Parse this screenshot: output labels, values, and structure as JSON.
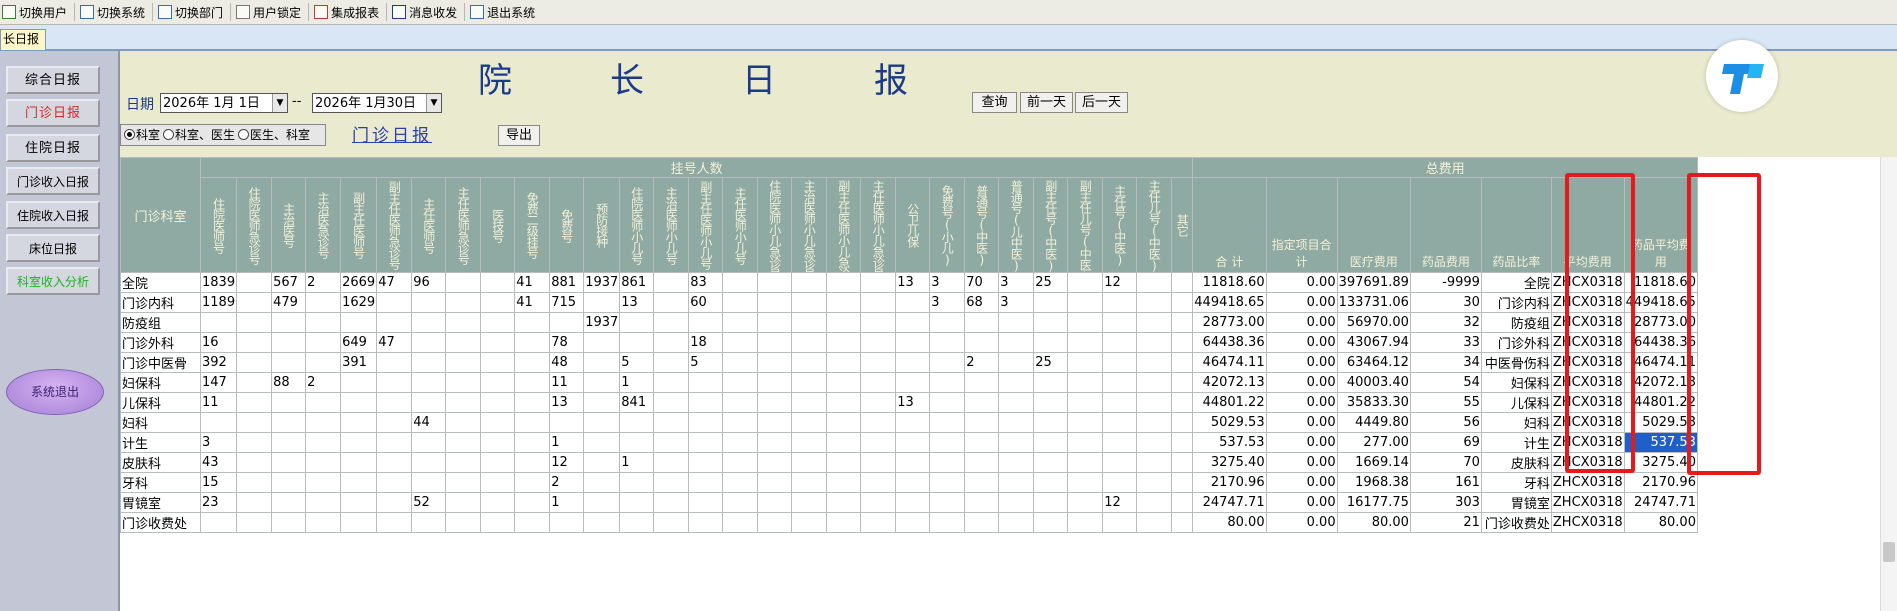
{
  "toolbar": {
    "items": [
      {
        "label": "切换用户",
        "icon": "switch-user-icon"
      },
      {
        "label": "切换系统",
        "icon": "switch-system-icon"
      },
      {
        "label": "切换部门",
        "icon": "switch-department-icon"
      },
      {
        "label": "用户锁定",
        "icon": "user-lock-icon"
      },
      {
        "label": "集成报表",
        "icon": "report-icon"
      },
      {
        "label": "消息收发",
        "icon": "info-icon"
      },
      {
        "label": "退出系统",
        "icon": "exit-icon"
      }
    ]
  },
  "tab": {
    "label": "长日报"
  },
  "nav": {
    "items": [
      {
        "label": "综合日报"
      },
      {
        "label": "门诊日报"
      },
      {
        "label": "住院日报"
      },
      {
        "label": "门诊收入日报"
      },
      {
        "label": "住院收入日报"
      },
      {
        "label": "床位日报"
      },
      {
        "label": "科室收入分析"
      }
    ],
    "oval_label": "系统退出"
  },
  "header": {
    "title": "院长日报",
    "date_label": "日期",
    "date_from": "2026年 1月 1日",
    "date_sep": "--",
    "date_to": "2026年 1月30日",
    "query_button": "查询",
    "prev_day_button": "前一天",
    "next_day_button": "后一天",
    "export_button": "导出",
    "radio_options": [
      "科室",
      "科室、医生",
      "医生、科室"
    ],
    "radio_selected": 0,
    "sub_title": "门诊日报"
  },
  "table": {
    "dept_header": "门诊科室",
    "group_registration": "挂号人数",
    "group_total_fee": "总费用",
    "reg_columns": [
      "住院医师号",
      "住院医师急诊号",
      "主治医号",
      "主治医急诊号",
      "副主任医师号",
      "副主任医师急诊号",
      "主任医师号",
      "主任医师急诊号",
      "医技号",
      "免费二级挂号",
      "免费号",
      "预防接种",
      "住院医师小儿号",
      "主治医师小儿号",
      "副主任医师小儿号",
      "主任医师小儿号",
      "住院医师小儿急诊号",
      "主治医师小儿急诊号",
      "副主任医师小儿急诊号",
      "主任医师小儿急诊号",
      "公卫儿保",
      "免费号(小儿)",
      "普通号(中医)",
      "普通号(儿中医)",
      "副主任号(中医)",
      "副主任儿号(中医)",
      "主任号(中医)",
      "主任儿号(中医)",
      "其它"
    ],
    "fee_columns": [
      "合  计",
      "指定项目合计",
      "医疗费用",
      "药品费用",
      "药品比率",
      "平均费用",
      "药品平均费用"
    ],
    "rows": [
      {
        "dept": "全院",
        "reg": [
          "1839",
          "",
          "567",
          "2",
          "2669",
          "47",
          "96",
          "",
          "",
          "41",
          "881",
          "1937",
          "861",
          "",
          "83",
          "",
          "",
          "",
          "",
          "",
          "13",
          "3",
          "70",
          "3",
          "25",
          "",
          "12",
          "",
          ""
        ],
        "fee": [
          "11818.60",
          "0.00",
          "397691.89",
          "-9999",
          "全院",
          "ZHCX0318",
          "11818.60"
        ]
      },
      {
        "dept": "门诊内科",
        "reg": [
          "1189",
          "",
          "479",
          "",
          "1629",
          "",
          "",
          "",
          "",
          "41",
          "715",
          "",
          "13",
          "",
          "60",
          "",
          "",
          "",
          "",
          "",
          "",
          "3",
          "68",
          "3",
          "",
          "",
          "",
          "",
          ""
        ],
        "fee": [
          "449418.65",
          "0.00",
          "133731.06",
          "30",
          "门诊内科",
          "ZHCX0318",
          "449418.65"
        ]
      },
      {
        "dept": "防疫组",
        "reg": [
          "",
          "",
          "",
          "",
          "",
          "",
          "",
          "",
          "",
          "",
          "",
          "1937",
          "",
          "",
          "",
          "",
          "",
          "",
          "",
          "",
          "",
          "",
          "",
          "",
          "",
          "",
          "",
          "",
          ""
        ],
        "fee": [
          "28773.00",
          "0.00",
          "56970.00",
          "32",
          "防疫组",
          "ZHCX0318",
          "28773.00"
        ]
      },
      {
        "dept": "门诊外科",
        "reg": [
          "16",
          "",
          "",
          "",
          "649",
          "47",
          "",
          "",
          "",
          "",
          "78",
          "",
          "",
          "",
          "18",
          "",
          "",
          "",
          "",
          "",
          "",
          "",
          "",
          "",
          "",
          "",
          "",
          "",
          ""
        ],
        "fee": [
          "64438.36",
          "0.00",
          "43067.94",
          "33",
          "门诊外科",
          "ZHCX0318",
          "64438.36"
        ]
      },
      {
        "dept": "门诊中医骨",
        "reg": [
          "392",
          "",
          "",
          "",
          "391",
          "",
          "",
          "",
          "",
          "",
          "48",
          "",
          "5",
          "",
          "5",
          "",
          "",
          "",
          "",
          "",
          "",
          "",
          "2",
          "",
          "25",
          "",
          "",
          "",
          ""
        ],
        "fee": [
          "46474.11",
          "0.00",
          "63464.12",
          "34",
          "中医骨伤科",
          "ZHCX0318",
          "46474.11"
        ]
      },
      {
        "dept": "妇保科",
        "reg": [
          "147",
          "",
          "88",
          "2",
          "",
          "",
          "",
          "",
          "",
          "",
          "11",
          "",
          "1",
          "",
          "",
          "",
          "",
          "",
          "",
          "",
          "",
          "",
          "",
          "",
          "",
          "",
          "",
          "",
          ""
        ],
        "fee": [
          "42072.13",
          "0.00",
          "40003.40",
          "54",
          "妇保科",
          "ZHCX0318",
          "42072.13"
        ]
      },
      {
        "dept": "儿保科",
        "reg": [
          "11",
          "",
          "",
          "",
          "",
          "",
          "",
          "",
          "",
          "",
          "13",
          "",
          "841",
          "",
          "",
          "",
          "",
          "",
          "",
          "",
          "13",
          "",
          "",
          "",
          "",
          "",
          "",
          "",
          ""
        ],
        "fee": [
          "44801.22",
          "0.00",
          "35833.30",
          "55",
          "儿保科",
          "ZHCX0318",
          "44801.22"
        ]
      },
      {
        "dept": "妇科",
        "reg": [
          "",
          "",
          "",
          "",
          "",
          "",
          "44",
          "",
          "",
          "",
          "",
          "",
          "",
          "",
          "",
          "",
          "",
          "",
          "",
          "",
          "",
          "",
          "",
          "",
          "",
          "",
          "",
          "",
          ""
        ],
        "fee": [
          "5029.53",
          "0.00",
          "4449.80",
          "56",
          "妇科",
          "ZHCX0318",
          "5029.53"
        ]
      },
      {
        "dept": "计生",
        "reg": [
          "3",
          "",
          "",
          "",
          "",
          "",
          "",
          "",
          "",
          "",
          "1",
          "",
          "",
          "",
          "",
          "",
          "",
          "",
          "",
          "",
          "",
          "",
          "",
          "",
          "",
          "",
          "",
          "",
          ""
        ],
        "fee": [
          "537.53",
          "0.00",
          "277.00",
          "69",
          "计生",
          "ZHCX0318",
          "537.53"
        ]
      },
      {
        "dept": "皮肤科",
        "reg": [
          "43",
          "",
          "",
          "",
          "",
          "",
          "",
          "",
          "",
          "",
          "12",
          "",
          "1",
          "",
          "",
          "",
          "",
          "",
          "",
          "",
          "",
          "",
          "",
          "",
          "",
          "",
          "",
          "",
          ""
        ],
        "fee": [
          "3275.40",
          "0.00",
          "1669.14",
          "70",
          "皮肤科",
          "ZHCX0318",
          "3275.40"
        ]
      },
      {
        "dept": "牙科",
        "reg": [
          "15",
          "",
          "",
          "",
          "",
          "",
          "",
          "",
          "",
          "",
          "2",
          "",
          "",
          "",
          "",
          "",
          "",
          "",
          "",
          "",
          "",
          "",
          "",
          "",
          "",
          "",
          "",
          "",
          ""
        ],
        "fee": [
          "2170.96",
          "0.00",
          "1968.38",
          "161",
          "牙科",
          "ZHCX0318",
          "2170.96"
        ]
      },
      {
        "dept": "胃镜室",
        "reg": [
          "23",
          "",
          "",
          "",
          "",
          "",
          "52",
          "",
          "",
          "",
          "1",
          "",
          "",
          "",
          "",
          "",
          "",
          "",
          "",
          "",
          "",
          "",
          "",
          "",
          "",
          "",
          "12",
          "",
          ""
        ],
        "fee": [
          "24747.71",
          "0.00",
          "16177.75",
          "303",
          "胃镜室",
          "ZHCX0318",
          "24747.71"
        ]
      },
      {
        "dept": "门诊收费处",
        "reg": [
          "",
          "",
          "",
          "",
          "",
          "",
          "",
          "",
          "",
          "",
          "",
          "",
          "",
          "",
          "",
          "",
          "",
          "",
          "",
          "",
          "",
          "",
          "",
          "",
          "",
          "",
          "",
          "",
          ""
        ],
        "fee": [
          "80.00",
          "0.00",
          "80.00",
          "21",
          "门诊收费处",
          "ZHCX0318",
          "80.00"
        ]
      }
    ]
  },
  "colors": {
    "header_bg": "#8fa9a3",
    "highlight": "#1e5fc8",
    "red_box": "#e61a1a",
    "title": "#1b3a8a"
  }
}
